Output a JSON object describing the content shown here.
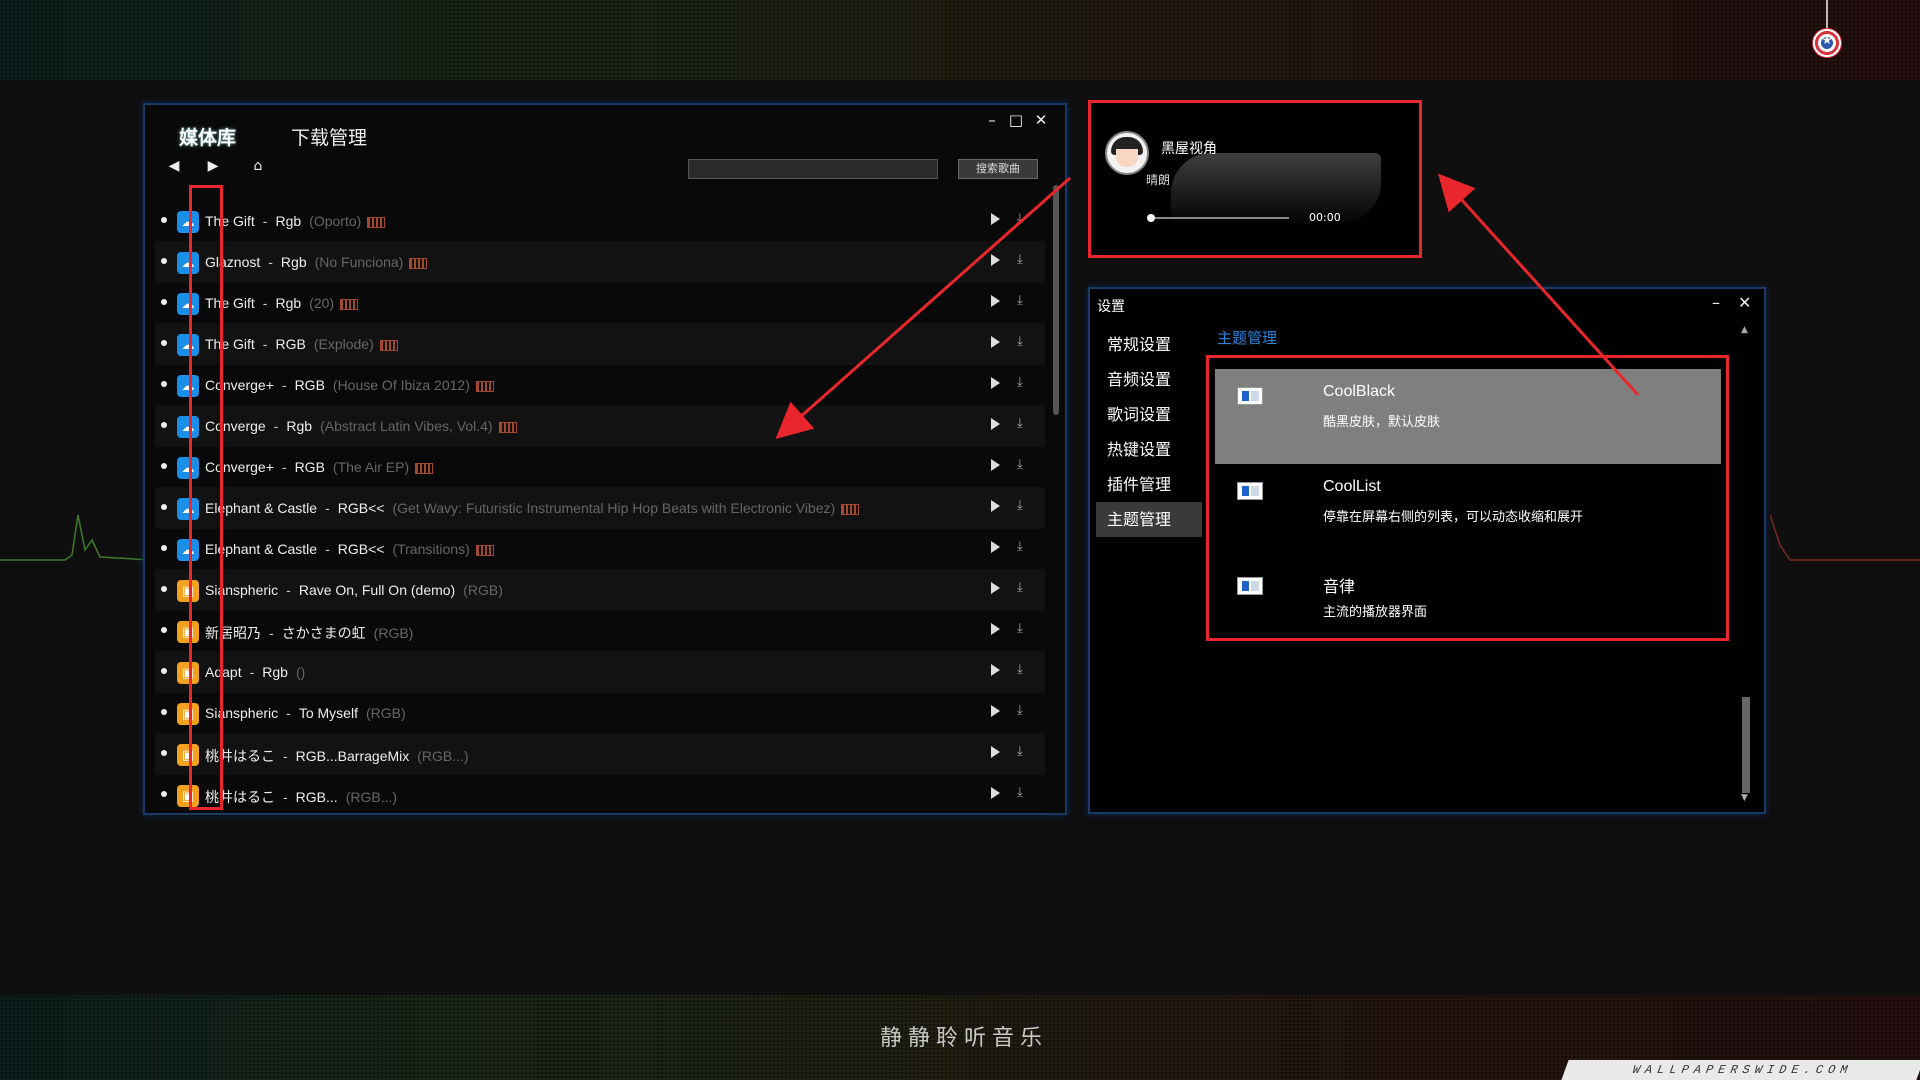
{
  "library": {
    "tabs": [
      "媒体库",
      "下载管理"
    ],
    "search_placeholder": "",
    "search_button": "搜索歌曲",
    "songs": [
      {
        "source": "cloud",
        "artist": "The Gift",
        "title": "Rgb",
        "album": "(Oporto)",
        "tag": true
      },
      {
        "source": "cloud",
        "artist": "Glaznost",
        "title": "Rgb",
        "album": "(No Funciona)",
        "tag": true
      },
      {
        "source": "cloud",
        "artist": "The Gift",
        "title": "Rgb",
        "album": "(20)",
        "tag": true
      },
      {
        "source": "cloud",
        "artist": "The Gift",
        "title": "RGB",
        "album": "(Explode)",
        "tag": true
      },
      {
        "source": "cloud",
        "artist": "Converge+",
        "title": "RGB",
        "album": "(House Of Ibiza 2012)",
        "tag": true
      },
      {
        "source": "cloud",
        "artist": "Converge",
        "title": "Rgb",
        "album": "(Abstract Latin Vibes, Vol.4)",
        "tag": true
      },
      {
        "source": "cloud",
        "artist": "Converge+",
        "title": "RGB",
        "album": "(The Air EP)",
        "tag": true
      },
      {
        "source": "cloud",
        "artist": "Elephant & Castle",
        "title": "RGB<<",
        "album": "(Get Wavy: Futuristic Instrumental Hip Hop Beats with Electronic Vibez)",
        "tag": true
      },
      {
        "source": "cloud",
        "artist": "Elephant & Castle",
        "title": "RGB<<",
        "album": "(Transitions)",
        "tag": true
      },
      {
        "source": "box",
        "artist": "Sianspheric",
        "title": "Rave On, Full On (demo)",
        "album": "(RGB)",
        "tag": false
      },
      {
        "source": "box",
        "artist": "新居昭乃",
        "title": "さかさまの虹",
        "album": "(RGB)",
        "tag": false
      },
      {
        "source": "box",
        "artist": "Adapt",
        "title": "Rgb",
        "album": "()",
        "tag": false
      },
      {
        "source": "box",
        "artist": "Sianspheric",
        "title": "To Myself",
        "album": "(RGB)",
        "tag": false
      },
      {
        "source": "box",
        "artist": "桃井はるこ",
        "title": "RGB...BarrageMix",
        "album": "(RGB...)",
        "tag": false
      },
      {
        "source": "box",
        "artist": "桃井はるこ",
        "title": "RGB...",
        "album": "(RGB...)",
        "tag": false
      }
    ]
  },
  "player": {
    "user_name": "黑屋视角",
    "status": "晴朗",
    "time": "00:00",
    "progress": 0
  },
  "settings": {
    "title": "设置",
    "menu": [
      "常规设置",
      "音频设置",
      "歌词设置",
      "热键设置",
      "插件管理",
      "主题管理"
    ],
    "active_menu": "主题管理",
    "section_title": "主题管理",
    "themes": [
      {
        "name": "CoolBlack",
        "desc": "酷黑皮肤，默认皮肤",
        "selected": true
      },
      {
        "name": "CoolList",
        "desc": "停靠在屏幕右侧的列表，可以动态收缩和展开",
        "selected": false
      },
      {
        "name": "音律",
        "desc": "主流的播放器界面",
        "selected": false
      }
    ]
  },
  "desktop": {
    "bottom_logo": "静静聆听音乐",
    "watermark": "WALLPAPERSWIDE.COM"
  },
  "colors": {
    "accent_blue": "#2b82d9",
    "annotation_red": "#e8262b",
    "cloud_icon": "#1b8ee8",
    "box_icon": "#f2a21f"
  }
}
